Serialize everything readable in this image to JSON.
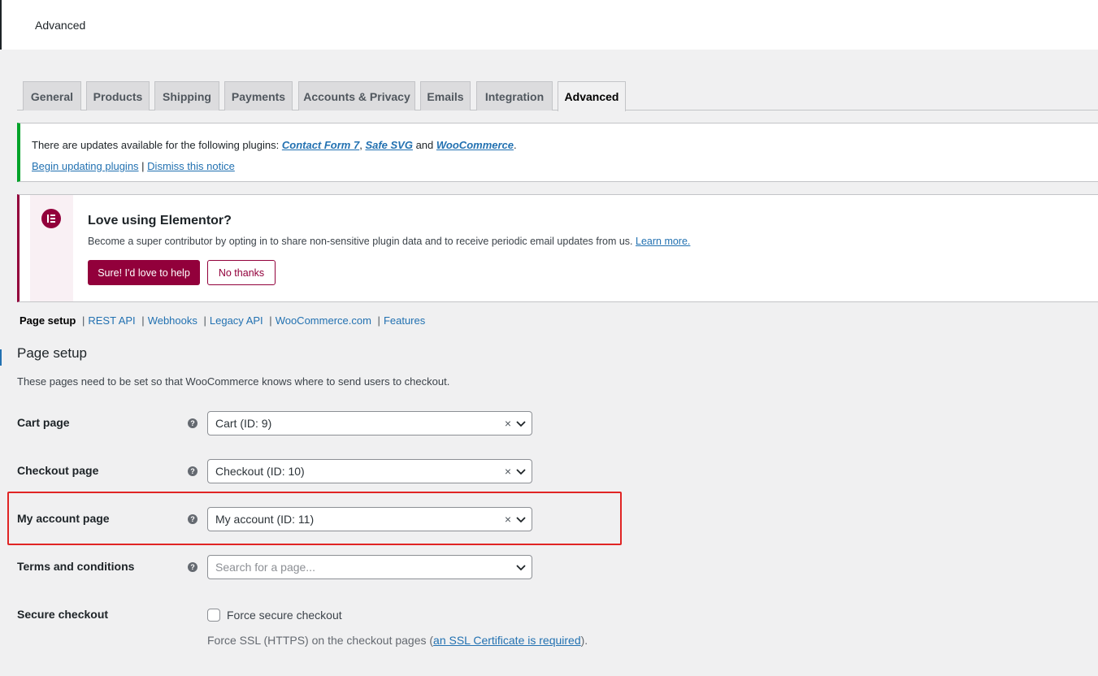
{
  "header": {
    "title": "Advanced"
  },
  "tabs": [
    {
      "label": "General"
    },
    {
      "label": "Products"
    },
    {
      "label": "Shipping"
    },
    {
      "label": "Payments"
    },
    {
      "label": "Accounts & Privacy"
    },
    {
      "label": "Emails"
    },
    {
      "label": "Integration"
    },
    {
      "label": "Advanced"
    }
  ],
  "update_notice": {
    "prefix": "There are updates available for the following plugins: ",
    "plugins": [
      "Contact Form 7",
      "Safe SVG",
      "WooCommerce"
    ],
    "sep1": ", ",
    "and": " and ",
    "end": ".",
    "begin_link": "Begin updating plugins",
    "divider": " | ",
    "dismiss_link": "Dismiss this notice",
    "accent_color": "#00a32a"
  },
  "elementor": {
    "title": "Love using Elementor?",
    "description": "Become a super contributor by opting in to share non-sensitive plugin data and to receive periodic email updates from us. ",
    "learn_more": "Learn more.",
    "primary_button": "Sure! I'd love to help",
    "secondary_button": "No thanks",
    "brand_color": "#92003b",
    "icon": "elementor-logo-icon"
  },
  "subnav": {
    "current": "Page setup",
    "links": [
      "REST API",
      "Webhooks",
      "Legacy API",
      "WooCommerce.com",
      "Features"
    ],
    "separator": "|"
  },
  "section": {
    "title": "Page setup",
    "description": "These pages need to be set so that WooCommerce knows where to send users to checkout."
  },
  "fields": {
    "cart": {
      "label": "Cart page",
      "value": "Cart (ID: 9)",
      "clear": "×"
    },
    "checkout": {
      "label": "Checkout page",
      "value": "Checkout (ID: 10)",
      "clear": "×"
    },
    "my_account": {
      "label": "My account page",
      "value": "My account (ID: 11)",
      "clear": "×"
    },
    "terms": {
      "label": "Terms and conditions",
      "placeholder": "Search for a page..."
    },
    "help_glyph": "?"
  },
  "secure_checkout": {
    "label": "Secure checkout",
    "checkbox_label": "Force secure checkout",
    "checked": false,
    "desc_prefix": "Force SSL (HTTPS) on the checkout pages (",
    "desc_link": "an SSL Certificate is required",
    "desc_suffix": ")."
  },
  "highlight_color": "#e02424"
}
